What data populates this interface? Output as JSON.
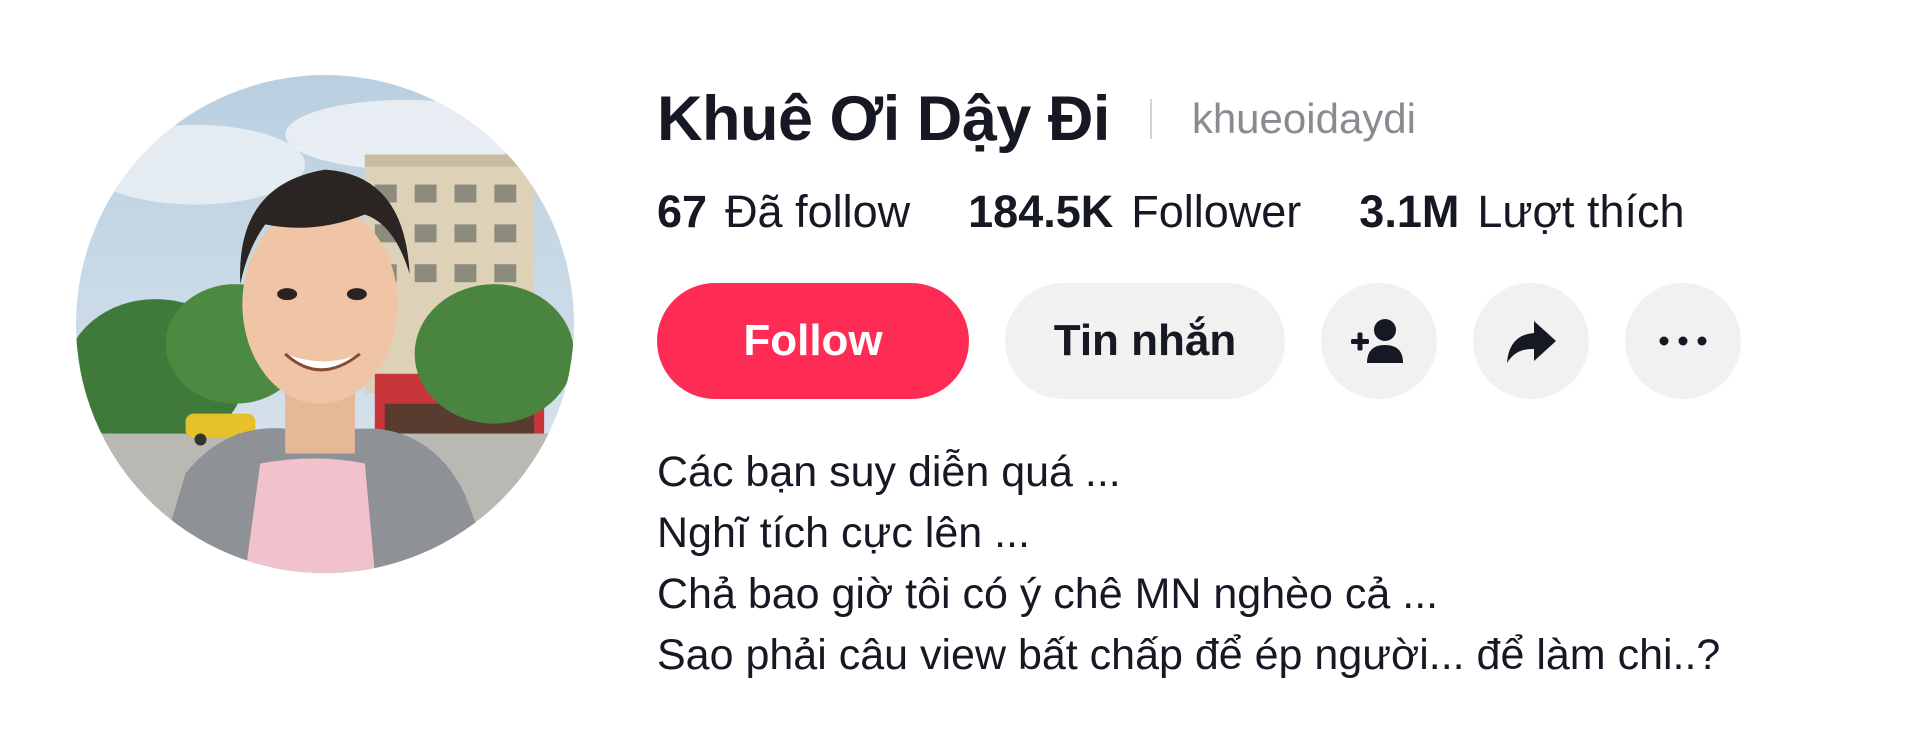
{
  "profile": {
    "display_name": "Khuê Ơi Dậy Đi",
    "username": "khueoidaydi",
    "avatar_icon": "profile-photo"
  },
  "stats": {
    "following_value": "67",
    "following_label": "Đã follow",
    "followers_value": "184.5K",
    "followers_label": "Follower",
    "likes_value": "3.1M",
    "likes_label": "Lượt thích"
  },
  "actions": {
    "follow_label": "Follow",
    "message_label": "Tin nhắn",
    "add_friend_icon": "add-user-icon",
    "share_icon": "share-arrow-icon",
    "more_icon": "more-dots-icon"
  },
  "bio": {
    "lines": [
      "Các bạn suy diễn quá ...",
      "Nghĩ tích cực lên ...",
      "Chả bao giờ tôi có ý chê MN nghèo cả ...",
      "Sao phải câu view bất chấp để ép người... để làm chi..?"
    ]
  },
  "colors": {
    "accent": "#fe2c55",
    "text_primary": "#161823",
    "text_secondary": "#8a8b91",
    "button_secondary_bg": "#f1f1f2"
  }
}
